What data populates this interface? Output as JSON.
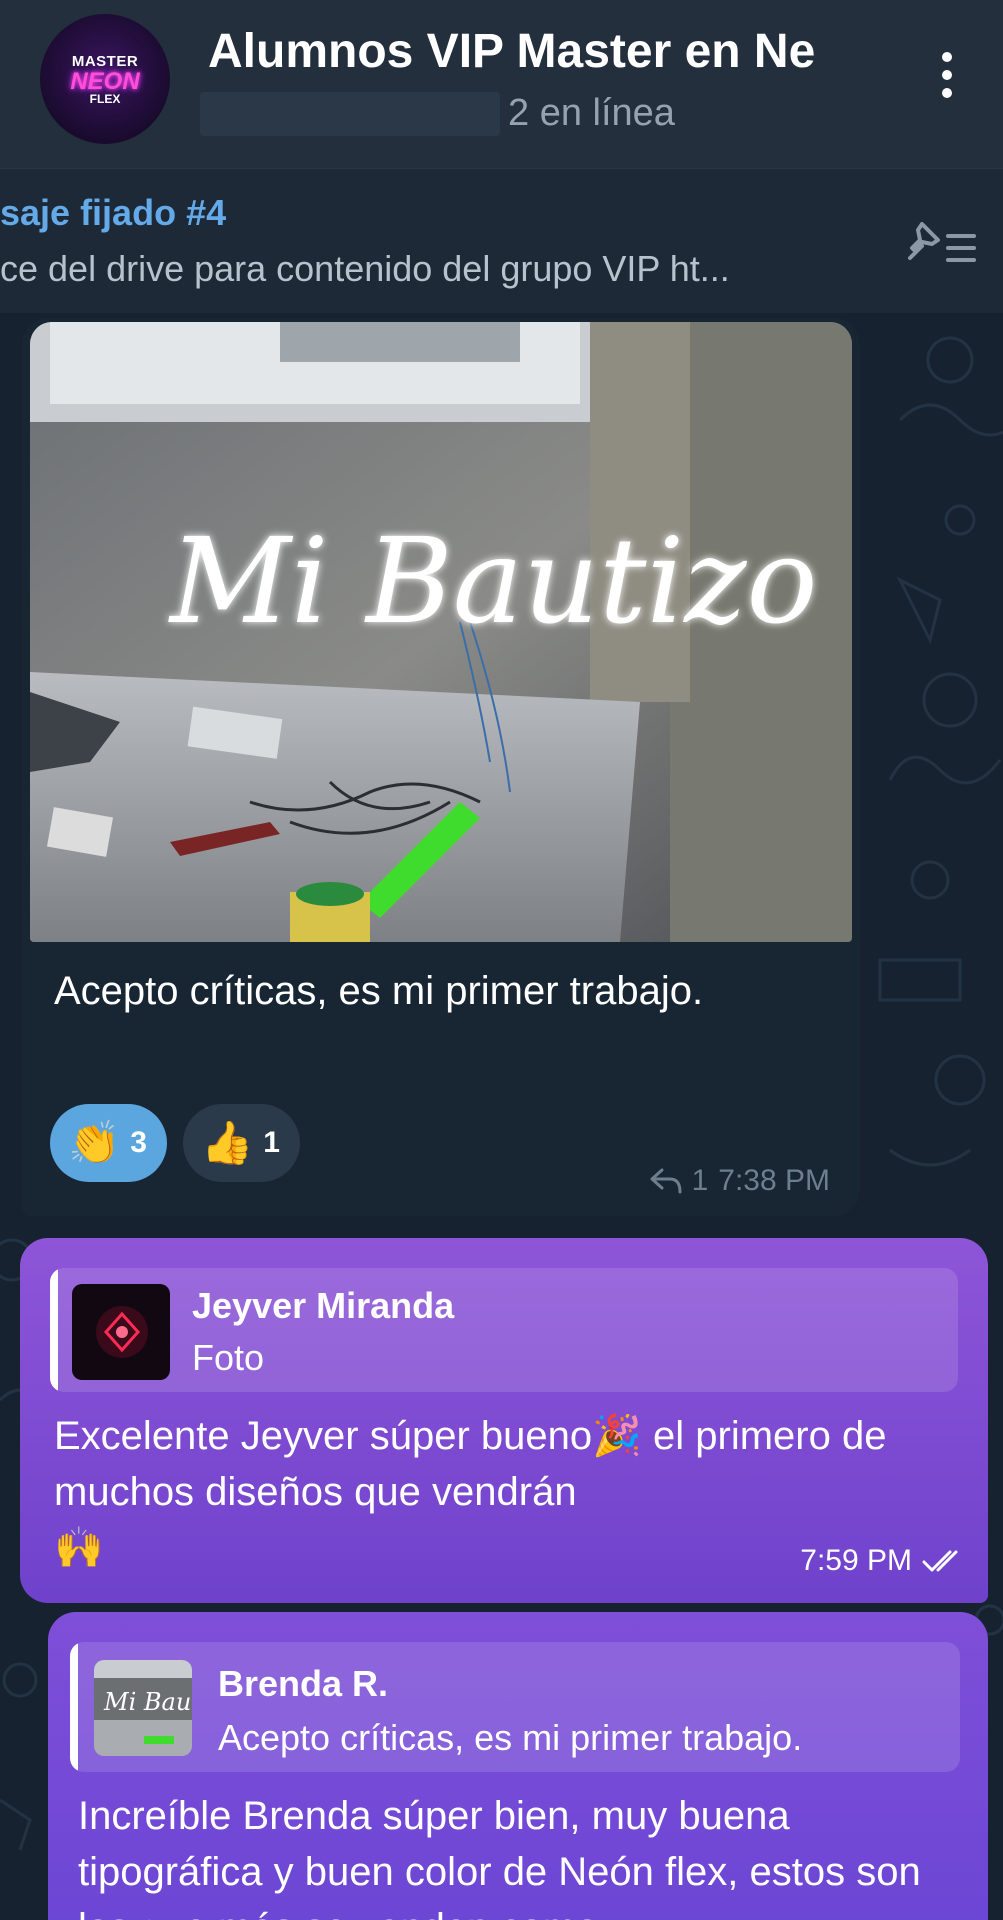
{
  "header": {
    "title": "Alumnos VIP Master en Ne",
    "status": "2 en línea",
    "avatar_lines": [
      "MASTER",
      "NEON",
      "FLEX"
    ]
  },
  "pinned": {
    "title": "saje fijado #4",
    "text": "ce del drive para contenido del grupo VIP   ht..."
  },
  "incoming": {
    "photo_sign_text": "Mi Bautizo",
    "caption": "Acepto críticas, es mi primer trabajo.",
    "reactions": [
      {
        "emoji": "👏",
        "count": "3",
        "active": true
      },
      {
        "emoji": "👍",
        "count": "1",
        "active": false
      }
    ],
    "reply_count": "1",
    "time": "7:38 PM"
  },
  "outgoing": [
    {
      "reply_name": "Jeyver Miranda",
      "reply_text": "Foto",
      "text_part1": "Excelente Jeyver súper bueno",
      "emoji1": "🎉",
      "text_part2": " el primero de muchos diseños que vendrán",
      "emoji2": "🙌",
      "time": "7:59 PM"
    },
    {
      "reply_name": "Brenda R.",
      "reply_text": "Acepto críticas, es mi primer trabajo.",
      "text": "Increíble Brenda súper bien, muy buena tipográfica y buen color de Neón flex, estos son los que más se venden como"
    }
  ],
  "colors": {
    "header_bg": "#232f3d",
    "chat_bg": "#172230",
    "incoming_bubble": "#182533",
    "outgoing_bubble": "#7b47d2",
    "pinned_accent": "#64a9e8",
    "reaction_active": "#5ba6de"
  },
  "icons": {
    "menu": "more-vertical-icon",
    "pin_list": "pin-list-icon",
    "reply": "reply-arrow-icon",
    "read": "double-check-icon"
  }
}
